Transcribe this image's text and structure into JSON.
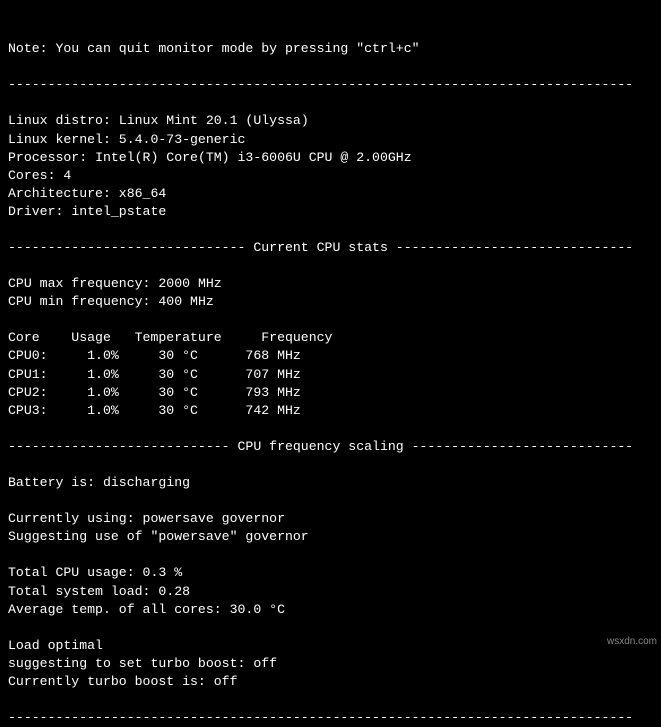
{
  "note": "Note: You can quit monitor mode by pressing \"ctrl+c\"",
  "hr": "-------------------------------------------------------------------------------",
  "sys": {
    "distro_label": "Linux distro: ",
    "distro": "Linux Mint 20.1 (Ulyssa)",
    "kernel_label": "Linux kernel: ",
    "kernel": "5.4.0-73-generic",
    "processor_label": "Processor: ",
    "processor": "Intel(R) Core(TM) i3-6006U CPU @ 2.00GHz",
    "cores_label": "Cores: ",
    "cores": "4",
    "arch_label": "Architecture: ",
    "arch": "x86_64",
    "driver_label": "Driver: ",
    "driver": "intel_pstate"
  },
  "hr_stats": "------------------------------ Current CPU stats ------------------------------",
  "stats": {
    "max_label": "CPU max frequency: ",
    "max": "2000 MHz",
    "min_label": "CPU min frequency: ",
    "min": "400 MHz",
    "header": "Core    Usage   Temperature     Frequency",
    "rows": [
      "CPU0:     1.0%     30 °C      768 MHz",
      "CPU1:     1.0%     30 °C      707 MHz",
      "CPU2:     1.0%     30 °C      793 MHz",
      "CPU3:     1.0%     30 °C      742 MHz"
    ]
  },
  "hr_scaling": "---------------------------- CPU frequency scaling ----------------------------",
  "scaling": {
    "battery_label": "Battery is: ",
    "battery": "discharging",
    "gov_current": "Currently using: powersave governor",
    "gov_suggest": "Suggesting use of \"powersave\" governor",
    "total_usage_label": "Total CPU usage: ",
    "total_usage": "0.3 %",
    "total_load_label": "Total system load: ",
    "total_load": "0.28",
    "avg_temp_label": "Average temp. of all cores: ",
    "avg_temp": "30.0 °C",
    "load_status": "Load optimal",
    "turbo_suggest": "suggesting to set turbo boost: off",
    "turbo_current": "Currently turbo boost is: off"
  },
  "watermark": "wsxdn.com",
  "chart_data": {
    "type": "table",
    "title": "Current CPU stats",
    "columns": [
      "Core",
      "Usage",
      "Temperature",
      "Frequency"
    ],
    "rows": [
      {
        "Core": "CPU0",
        "Usage": "1.0%",
        "Temperature": "30 °C",
        "Frequency": "768 MHz"
      },
      {
        "Core": "CPU1",
        "Usage": "1.0%",
        "Temperature": "30 °C",
        "Frequency": "707 MHz"
      },
      {
        "Core": "CPU2",
        "Usage": "1.0%",
        "Temperature": "30 °C",
        "Frequency": "793 MHz"
      },
      {
        "Core": "CPU3",
        "Usage": "1.0%",
        "Temperature": "30 °C",
        "Frequency": "742 MHz"
      }
    ]
  }
}
